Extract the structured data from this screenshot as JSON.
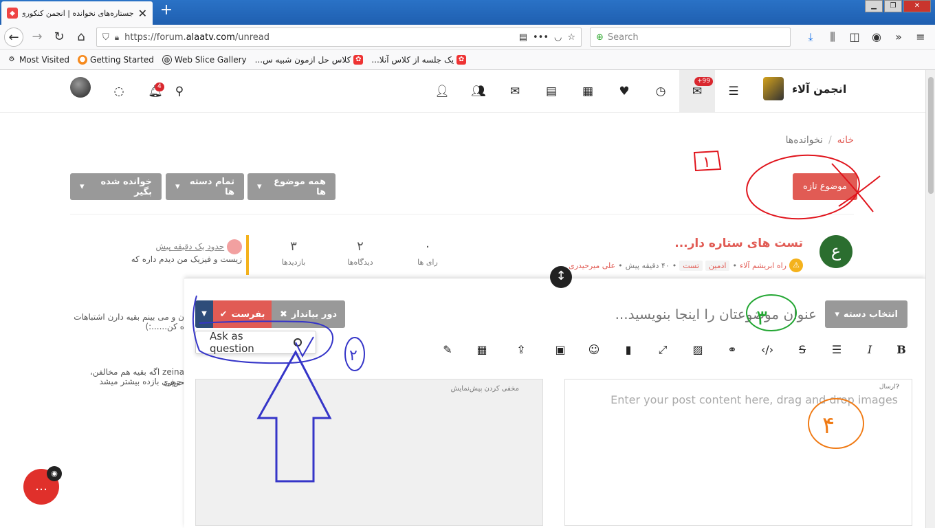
{
  "browser": {
    "tab_title": "جستاره‌های نخوانده | انجمن کنکوری",
    "url_prefix": "https://forum.",
    "url_domain": "alaatv.com",
    "url_path": "/unread",
    "search_placeholder": "Search",
    "bookmarks": [
      {
        "label": "Most Visited",
        "icon": "gear-icon"
      },
      {
        "label": "Getting Started",
        "icon": "firefox-icon"
      },
      {
        "label": "Web Slice Gallery",
        "icon": "globe-icon"
      },
      {
        "label": "کلاس حل ازمون شبیه س...",
        "icon": "alaa-icon"
      },
      {
        "label": "یک جلسه از کلاس آنلا...",
        "icon": "alaa-icon"
      }
    ]
  },
  "header": {
    "brand_name": "انجمن آلاء",
    "notifications_badge": "4",
    "unread_badge": "+99"
  },
  "breadcrumb": {
    "home": "خانه",
    "sep": "/",
    "current": "نخوانده‌ها"
  },
  "buttons": {
    "new_topic": "موضوع تازه",
    "all_topics": "همه موضوع ها",
    "all_categories": "تمام دسته ها",
    "mark_read": "خوانده شده بگیر"
  },
  "topic": {
    "title": "تست های ستاره دار...",
    "avatar_letter": "ع",
    "category": "راه ابریشم آلاء",
    "tags": [
      "ادمین",
      "تست"
    ],
    "time": "۴۰ دقیقه پیش",
    "author": "علی میرحیدری",
    "votes": "۰",
    "votes_label": "رای ها",
    "posts": "۲",
    "posts_label": "دیدگاه‌ها",
    "views": "۳",
    "views_label": "بازدیدها",
    "last_when": "حدود یک دقیقه پیش",
    "last_text": "زیست و فیزیک من دیدم داره که"
  },
  "background_snippets": [
    "ن و می بینم بقیه دارن اشتباهات",
    "ه کن......:)",
    "zeina اگه بقیه هم مخالفن، حرفی",
    "،جوری بازده بیشتر میشد"
  ],
  "composer": {
    "category_select": "انتخاب دسته",
    "title_placeholder": "عنوان موضوعتان را اینجا بنویسید...",
    "discard": "دور بیانداز",
    "submit": "بفرست",
    "dropdown_option": "Ask as question",
    "hide_preview": "مخفی کردن پیش‌نمایش",
    "help_label": "ارسال",
    "editor_placeholder": "Enter your post content here, drag and drop images"
  },
  "annotations": {
    "n1": "۱",
    "n2": "۲",
    "n3": "۳",
    "n4": "۴"
  },
  "colors": {
    "accent": "#e15b54",
    "header_blue": "#1f5fb0",
    "dropdown_blue": "#2e4d7a",
    "annot_red": "#e0141c",
    "annot_blue": "#3535c8",
    "annot_green": "#22a632",
    "annot_orange": "#f07a14"
  }
}
